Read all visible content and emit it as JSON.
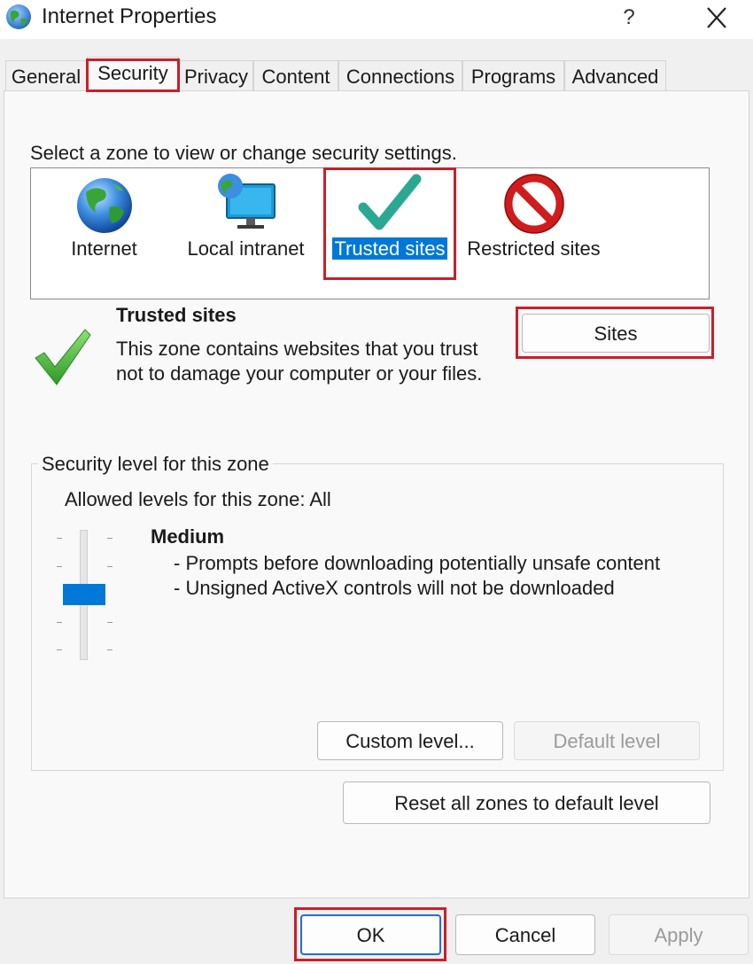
{
  "window": {
    "title": "Internet Properties",
    "help_label": "?",
    "close_icon": "close-icon"
  },
  "tabs": [
    {
      "label": "General"
    },
    {
      "label": "Security",
      "active": true
    },
    {
      "label": "Privacy"
    },
    {
      "label": "Content"
    },
    {
      "label": "Connections"
    },
    {
      "label": "Programs"
    },
    {
      "label": "Advanced"
    }
  ],
  "security": {
    "zone_prompt": "Select a zone to view or change security settings.",
    "zones": [
      {
        "label": "Internet",
        "icon": "globe-icon"
      },
      {
        "label": "Local intranet",
        "icon": "monitor-globe-icon"
      },
      {
        "label": "Trusted sites",
        "icon": "checkmark-icon",
        "selected": true
      },
      {
        "label": "Restricted sites",
        "icon": "no-entry-icon"
      }
    ],
    "selected_zone": {
      "title": "Trusted sites",
      "description": "This zone contains websites that you trust not to damage your computer or your files.",
      "sites_button": "Sites"
    },
    "level_group": {
      "legend": "Security level for this zone",
      "allowed": "Allowed levels for this zone: All",
      "level_name": "Medium",
      "bullets": [
        "- Prompts before downloading potentially unsafe content",
        "- Unsigned ActiveX controls will not be downloaded"
      ],
      "slider_level": "3 of 5",
      "custom_button": "Custom level...",
      "default_button": "Default level"
    },
    "reset_button": "Reset all zones to default level"
  },
  "footer": {
    "ok": "OK",
    "cancel": "Cancel",
    "apply": "Apply"
  },
  "colors": {
    "highlight": "#cc1e2a",
    "accent": "#0078d7"
  }
}
